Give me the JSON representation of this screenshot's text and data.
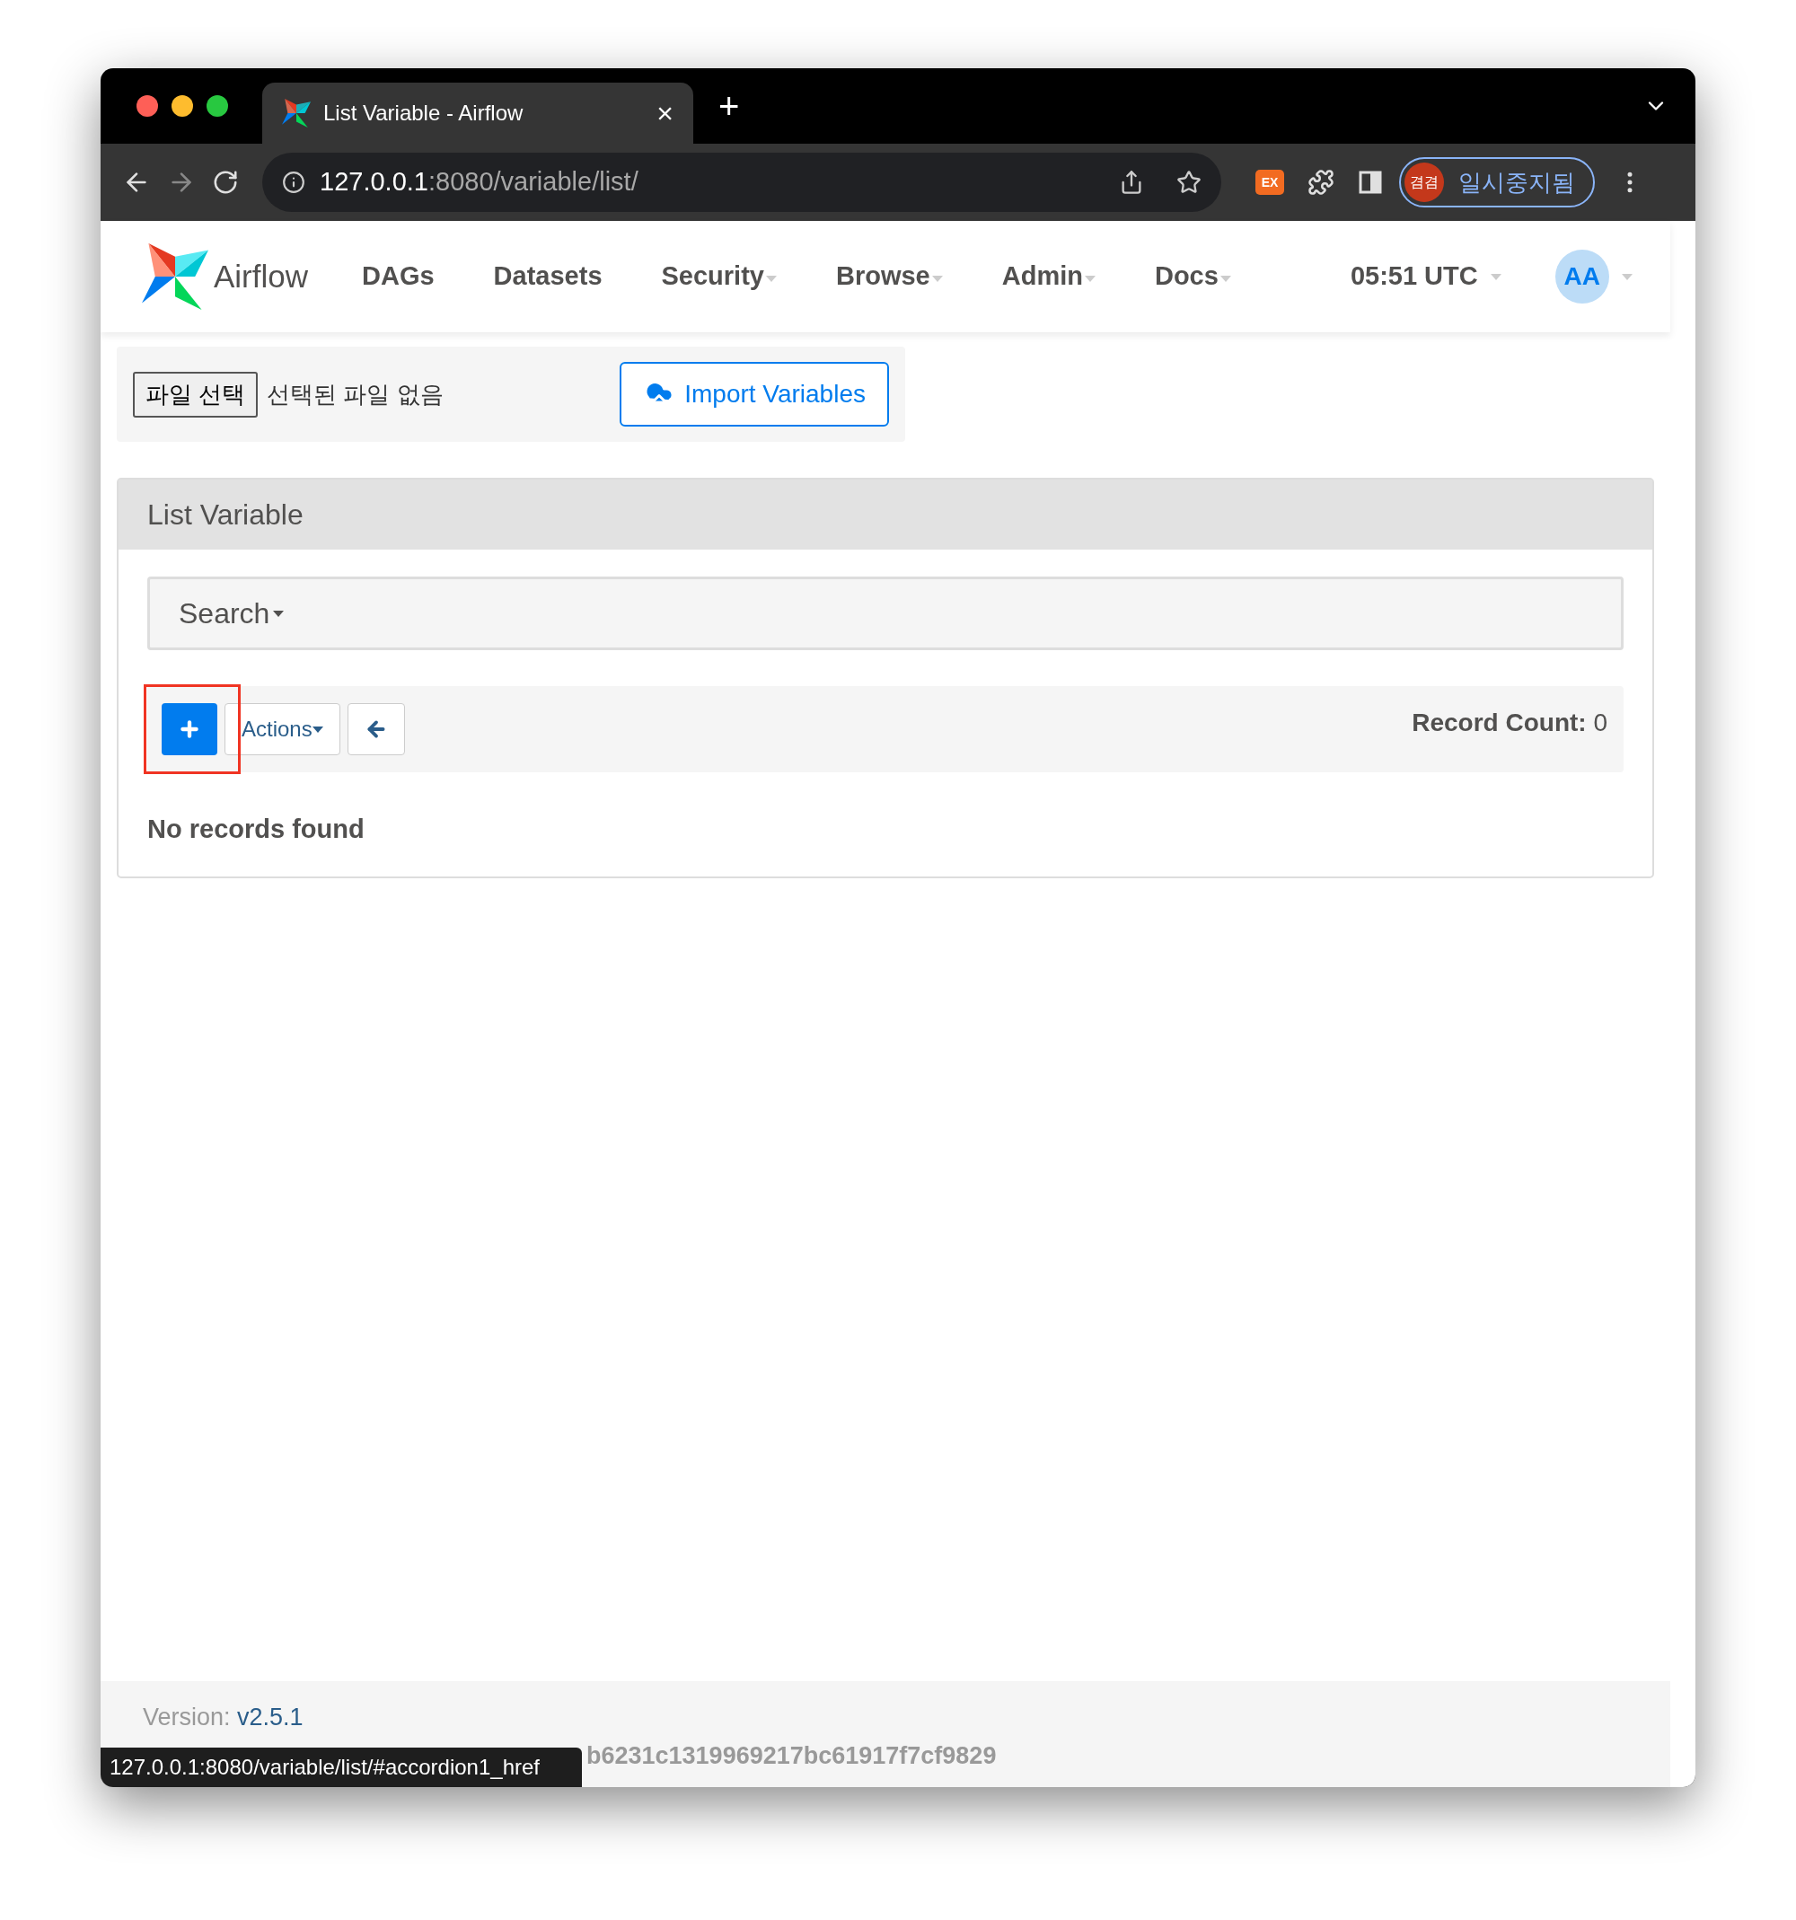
{
  "browser": {
    "tab": {
      "title": "List Variable - Airflow",
      "close": "×"
    },
    "new_tab": "+",
    "address": {
      "host": "127.0.0.1",
      "rest": ":8080/variable/list/"
    },
    "extension": "EX",
    "profile": {
      "avatar": "겸겸",
      "label": "일시중지됨"
    }
  },
  "navbar": {
    "brand": "Airflow",
    "items": [
      {
        "label": "DAGs",
        "dropdown": false
      },
      {
        "label": "Datasets",
        "dropdown": false
      },
      {
        "label": "Security",
        "dropdown": true
      },
      {
        "label": "Browse",
        "dropdown": true
      },
      {
        "label": "Admin",
        "dropdown": true
      },
      {
        "label": "Docs",
        "dropdown": true
      }
    ],
    "clock": "05:51 UTC",
    "user": "AA"
  },
  "import": {
    "file_button": "파일 선택",
    "file_status": "선택된 파일 없음",
    "import_button": "Import Variables"
  },
  "panel": {
    "title": "List Variable",
    "search": "Search",
    "add_highlighted": true,
    "actions": "Actions",
    "record_count_label": "Record Count:",
    "record_count": "0",
    "empty": "No records found"
  },
  "footer": {
    "version_label": "Version:",
    "version": "v2.5.1",
    "git_version": "b6231c1319969217bc61917f7cf9829"
  },
  "status_url": "127.0.0.1:8080/variable/list/#accordion1_href"
}
